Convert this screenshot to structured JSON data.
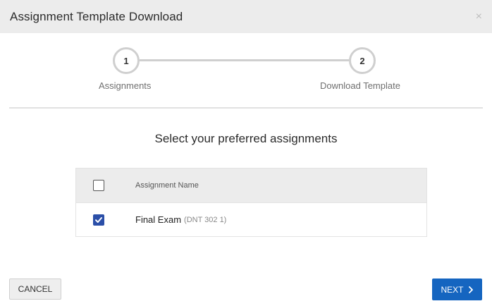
{
  "dialog": {
    "title": "Assignment Template Download",
    "close_icon": "×"
  },
  "stepper": {
    "steps": [
      {
        "number": "1",
        "label": "Assignments"
      },
      {
        "number": "2",
        "label": "Download Template"
      }
    ]
  },
  "main": {
    "prompt": "Select your preferred assignments",
    "table": {
      "column_header": "Assignment Name",
      "header_checked": false,
      "rows": [
        {
          "name": "Final Exam",
          "code": "(DNT 302 1)",
          "checked": true
        }
      ]
    }
  },
  "footer": {
    "cancel_label": "CANCEL",
    "next_label": "NEXT"
  },
  "colors": {
    "primary": "#1565c0",
    "checkbox_checked": "#2b4fa8",
    "header_bg": "#ececec"
  }
}
